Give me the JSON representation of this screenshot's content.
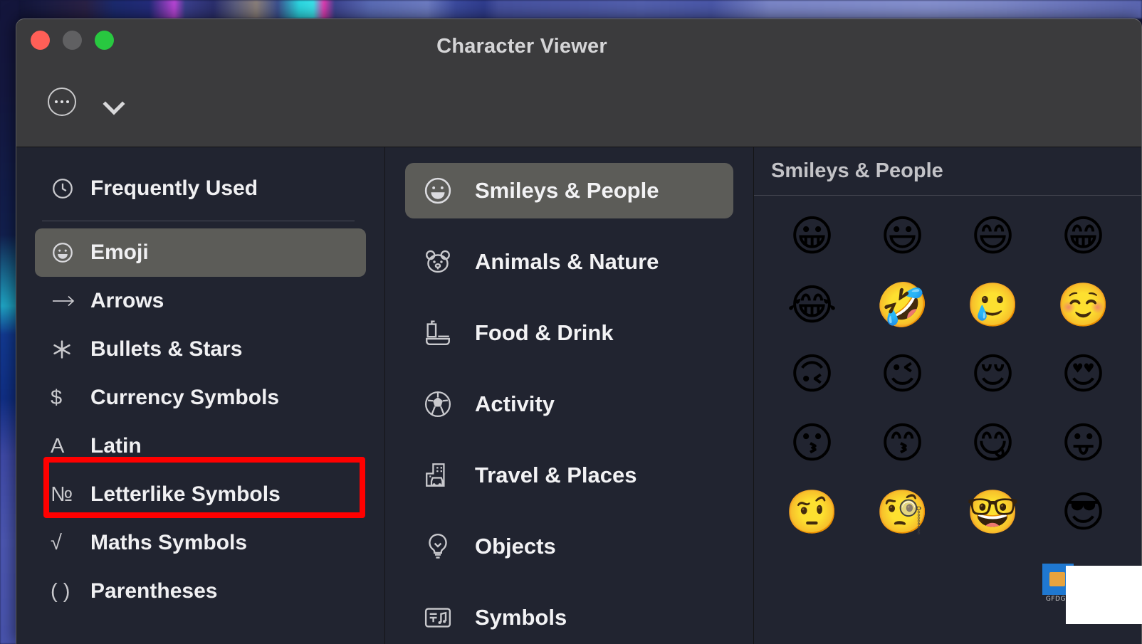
{
  "window": {
    "title": "Character Viewer",
    "traffic_lights": [
      {
        "name": "close",
        "color": "#ff5f57"
      },
      {
        "name": "minimize",
        "color": "#606062"
      },
      {
        "name": "maximize",
        "color": "#28c840"
      }
    ]
  },
  "toolbar": {
    "more_button": "more-options-icon",
    "chevron_button": "chevron-down-icon"
  },
  "sidebar": {
    "items": [
      {
        "label": "Frequently Used",
        "icon": "clock-icon",
        "selected": false
      },
      {
        "label": "Emoji",
        "icon": "smiley-icon",
        "selected": true
      },
      {
        "label": "Arrows",
        "icon": "arrow-right-icon",
        "selected": false
      },
      {
        "label": "Bullets & Stars",
        "icon": "asterisk-icon",
        "selected": false
      },
      {
        "label": "Currency Symbols",
        "icon": "dollar-icon",
        "selected": false
      },
      {
        "label": "Latin",
        "icon": "letter-a-icon",
        "selected": false
      },
      {
        "label": "Letterlike Symbols",
        "icon": "numero-icon",
        "selected": false
      },
      {
        "label": "Maths Symbols",
        "icon": "square-root-icon",
        "selected": false
      },
      {
        "label": "Parentheses",
        "icon": "parentheses-icon",
        "selected": false
      }
    ],
    "separator_after_index": 0,
    "highlight": {
      "target_label": "Letterlike Symbols",
      "color": "#ff0000"
    }
  },
  "categories": {
    "items": [
      {
        "label": "Smileys & People",
        "icon": "smiley-face-icon",
        "selected": true
      },
      {
        "label": "Animals & Nature",
        "icon": "bear-icon",
        "selected": false
      },
      {
        "label": "Food & Drink",
        "icon": "burger-drink-icon",
        "selected": false
      },
      {
        "label": "Activity",
        "icon": "soccer-ball-icon",
        "selected": false
      },
      {
        "label": "Travel & Places",
        "icon": "city-car-icon",
        "selected": false
      },
      {
        "label": "Objects",
        "icon": "lightbulb-icon",
        "selected": false
      },
      {
        "label": "Symbols",
        "icon": "symbols-icon",
        "selected": false
      }
    ]
  },
  "grid": {
    "header": "Smileys & People",
    "emojis": [
      "😀",
      "😃",
      "😄",
      "😁",
      "😂",
      "🤣",
      "🥲",
      "☺️",
      "🙃",
      "😉",
      "😌",
      "😍",
      "😗",
      "😙",
      "😋",
      "😛",
      "🤨",
      "🧐",
      "🤓",
      "😎"
    ]
  },
  "artifact": {
    "desktop_icon_caption": "GFDGS"
  }
}
